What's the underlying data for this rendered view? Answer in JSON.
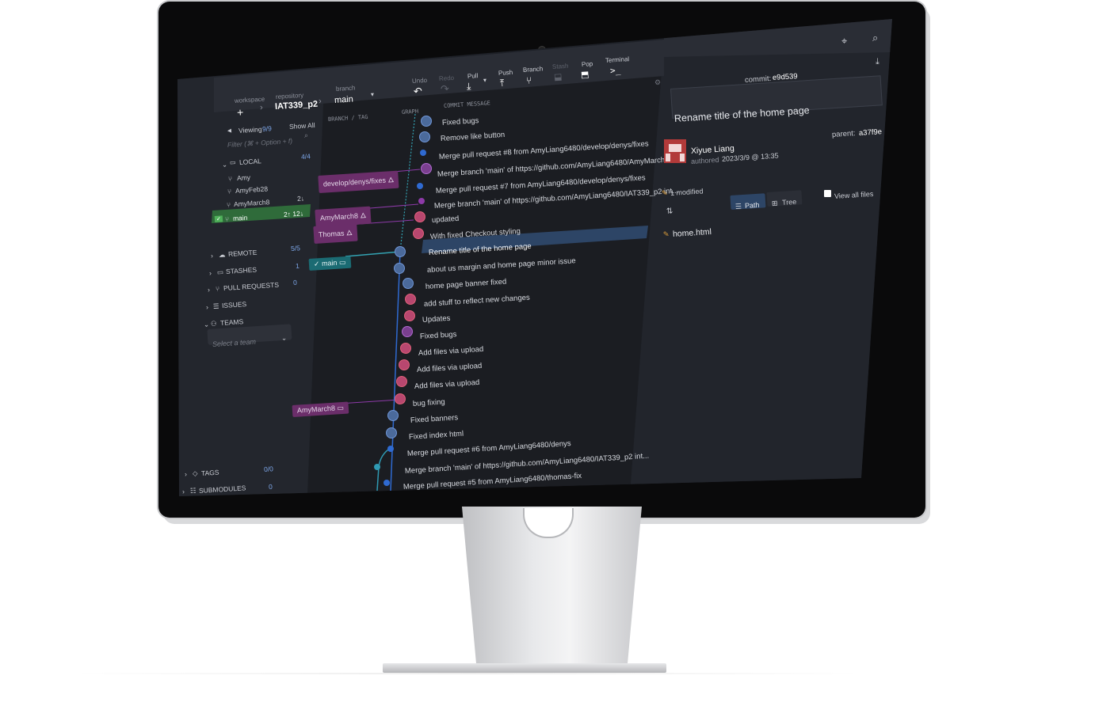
{
  "toolbar": {
    "workspace_label": "workspace",
    "repository_label": "repository",
    "repository_name": "IAT339_p2",
    "branch_label": "branch",
    "branch_name": "main",
    "undo": "Undo",
    "redo": "Redo",
    "pull": "Pull",
    "push": "Push",
    "branch": "Branch",
    "stash": "Stash",
    "pop": "Pop",
    "terminal": "Terminal"
  },
  "sidebar": {
    "viewing_label": "Viewing",
    "viewing_count": "9/9",
    "show_all": "Show All",
    "filter_placeholder": "Filter (⌘ + Option + f)",
    "local_label": "LOCAL",
    "local_count": "4/4",
    "branches": [
      {
        "name": "Amy",
        "status": ""
      },
      {
        "name": "AmyFeb28",
        "status": ""
      },
      {
        "name": "AmyMarch8",
        "status": "2↓"
      },
      {
        "name": "main",
        "status": "2↑ 12↓"
      }
    ],
    "remote_label": "REMOTE",
    "remote_count": "5/5",
    "stashes_label": "STASHES",
    "stashes_count": "1",
    "pull_requests_label": "PULL REQUESTS",
    "pull_requests_count": "0",
    "issues_label": "ISSUES",
    "teams_label": "TEAMS",
    "team_select_placeholder": "Select a team",
    "tags_label": "TAGS",
    "tags_count": "0/0",
    "submodules_label": "SUBMODULES",
    "submodules_count": "0"
  },
  "graph": {
    "col_branch_tag": "BRANCH / TAG",
    "col_graph": "GRAPH",
    "col_commit_message": "COMMIT MESSAGE",
    "branch_tags": [
      {
        "label": "develop/denys/fixes"
      },
      {
        "label": "AmyMarch8"
      },
      {
        "label": "Thomas"
      },
      {
        "label": "main"
      },
      {
        "label": "AmyMarch8"
      }
    ],
    "commits": [
      "Fixed bugs",
      "Remove like button",
      "Merge pull request #8 from AmyLiang6480/develop/denys/fixes",
      "Merge branch 'main' of https://github.com/AmyLiang6480/AmyMarch8",
      "Merge pull request #7 from AmyLiang6480/develop/denys/fixes",
      "Merge branch 'main' of https://github.com/AmyLiang6480/IAT339_p2 int...",
      "updated",
      "With fixed Checkout styling",
      "Rename title of the home page",
      "about us margin and home page minor issue",
      "home page banner fixed",
      "add stuff to reflect new changes",
      "Updates",
      "Fixed bugs",
      "Add files via upload",
      "Add files via upload",
      "Add files via upload",
      "bug fixing",
      "Fixed banners",
      "Fixed index html",
      "Merge pull request #6 from AmyLiang6480/denys",
      "Merge branch 'main' of https://github.com/AmyLiang6480/IAT339_p2 int...",
      "Merge pull request #5 from AmyLiang6480/thomas-fix"
    ]
  },
  "detail": {
    "commit_label": "commit:",
    "commit_hash": "e9d539",
    "summary": "Rename title of the home page",
    "parent_label": "parent:",
    "parent_hash": "a37f9e",
    "author_name": "Xiyue Liang",
    "authored_label": "authored",
    "authored_date": "2023/3/9 @ 13:35",
    "modified_count": "1 modified",
    "path_label": "Path",
    "tree_label": "Tree",
    "view_all_files": "View all files",
    "files": [
      "home.html"
    ]
  },
  "colors": {
    "selected_row": "#2d4566",
    "main_branch_row": "#2f6b3a",
    "branch_tag_purple": "#6b2e6a",
    "branch_tag_teal": "#1b6b73",
    "accent_blue": "#2f6ad1"
  }
}
